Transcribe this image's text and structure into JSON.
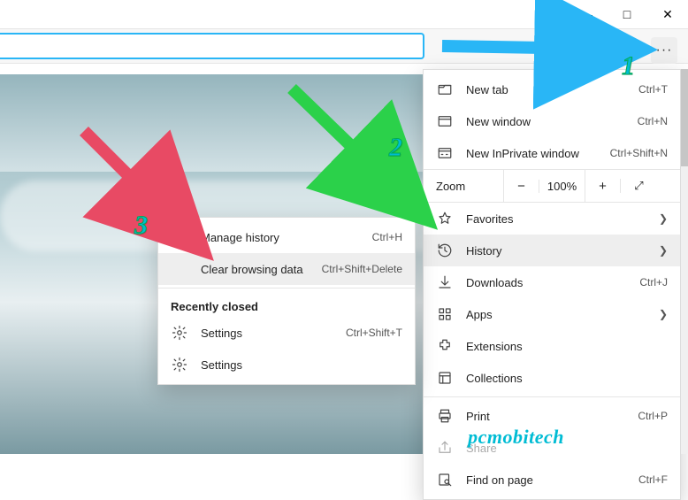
{
  "window": {
    "min": "—",
    "max": "□",
    "close": "✕"
  },
  "more_glyph": "···",
  "main_menu": [
    {
      "icon": "tab",
      "label": "New tab",
      "shortcut": "Ctrl+T"
    },
    {
      "icon": "window",
      "label": "New window",
      "shortcut": "Ctrl+N"
    },
    {
      "icon": "inprivate",
      "label": "New InPrivate window",
      "shortcut": "Ctrl+Shift+N"
    },
    {
      "type": "zoom"
    },
    {
      "icon": "star",
      "label": "Favorites",
      "chev": true
    },
    {
      "icon": "history",
      "label": "History",
      "chev": true,
      "selected": true
    },
    {
      "icon": "download",
      "label": "Downloads",
      "shortcut": "Ctrl+J"
    },
    {
      "icon": "apps",
      "label": "Apps",
      "chev": true
    },
    {
      "icon": "ext",
      "label": "Extensions"
    },
    {
      "icon": "collections",
      "label": "Collections"
    },
    {
      "type": "sep"
    },
    {
      "icon": "print",
      "label": "Print",
      "shortcut": "Ctrl+P"
    },
    {
      "icon": "share",
      "label": "Share",
      "disabled": true
    },
    {
      "icon": "find",
      "label": "Find on page",
      "shortcut": "Ctrl+F"
    }
  ],
  "zoom": {
    "label": "Zoom",
    "minus": "−",
    "value": "100%",
    "plus": "+",
    "fs": "⤢"
  },
  "sub_menu": {
    "rows": [
      {
        "icon": "history",
        "label": "Manage history",
        "shortcut": "Ctrl+H"
      },
      {
        "icon": "",
        "label": "Clear browsing data",
        "shortcut": "Ctrl+Shift+Delete",
        "selected": true
      }
    ],
    "head": "Recently closed",
    "recent": [
      {
        "icon": "gear",
        "label": "Settings",
        "shortcut": "Ctrl+Shift+T"
      },
      {
        "icon": "gear",
        "label": "Settings"
      }
    ]
  },
  "annot": {
    "n1": "1",
    "n2": "2",
    "n3": "3"
  },
  "watermark": "pcmobitech"
}
